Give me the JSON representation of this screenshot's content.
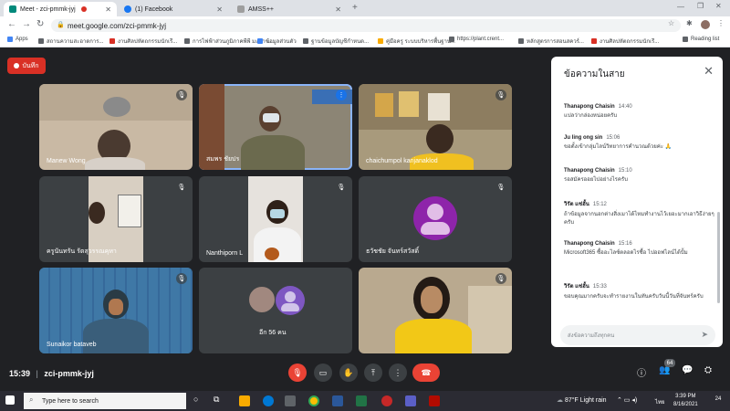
{
  "browser": {
    "tabs": [
      {
        "title": "Meet - zci-pmmk-jyj",
        "active": true
      },
      {
        "title": "(1) Facebook",
        "active": false
      },
      {
        "title": "AMSS++",
        "active": false
      }
    ],
    "url": "meet.google.com/zci-pmmk-jyj",
    "bookmarks": [
      "Apps",
      "สถานความสะอาดการ...",
      "งานศิลปหัตถกรรมนักเรี...",
      "การไฟฟ้าส่วนภูมิภาคพีพี มะนาว...",
      "ข้อมูลส่วนตัว",
      "ฐานข้อมูลบัญชีกำหนด...",
      "คู่มือครู ระบบบริหารพื้นฐาน...",
      "https://plant.crent...",
      "หลักสูตรการสอนสควร์...",
      "งานศิลปหัตถกรรมนักเรี..."
    ],
    "reading_list": "Reading list"
  },
  "meet": {
    "record_label": "บันทึก",
    "meeting_code": "zci-pmmk-jyj",
    "time": "15:39",
    "participant_count": "64",
    "tiles": [
      {
        "name": "Manew Wong",
        "type": "video"
      },
      {
        "name": "สมพร ชัยปร",
        "type": "video",
        "speaking": true
      },
      {
        "name": "chaichumpol kanjanaklod",
        "type": "video"
      },
      {
        "name": "ครูนันทรัน รัตสุวรรณคุหา",
        "type": "video"
      },
      {
        "name": "Nanthiporn L",
        "type": "video"
      },
      {
        "name": "ธวัชชัย จันทร์สวัสดิ์",
        "type": "avatar"
      },
      {
        "name": "Sunaikor bataveb",
        "type": "video"
      },
      {
        "name": "อีก 56 คน",
        "type": "others"
      },
      {
        "name": "",
        "type": "video"
      }
    ]
  },
  "chat": {
    "title": "ข้อความในสาย",
    "messages": [
      {
        "sender": "Thanapong Chaisin",
        "time": "14:40",
        "text": "แปลว่ากล่องหน่อยครับ"
      },
      {
        "sender": "Ju ling ong sin",
        "time": "15:06",
        "text": "ขอตั้งเข้ากลุ่มไลน์วิทยาการคำนวณด้วยค่ะ 🙏"
      },
      {
        "sender": "Thanapong Chaisin",
        "time": "15:10",
        "text": "รอสมัครออยไปอย่างไรครับ"
      },
      {
        "sender": "วิรัต แซ่ฮั้น",
        "time": "15:12",
        "text": "ถ้าข้อมูลจากนอกต่างสิ่งเมาได้ไหมทำงานไว้เยอะมากเอาวิธีง่ายๆครับ"
      },
      {
        "sender": "Thanapong Chaisin",
        "time": "15:16",
        "text": "Microsoft365 ซื้ออะไลซ์ตลอดไรซื้อ ไปออฟไลน์ได้ปั้ม"
      },
      {
        "sender": "วิรัต แซ่ฮั้น",
        "time": "15:33",
        "text": "ขอบคุณมากครับจะทำรายงานในทันครับวันนี้วันที่จันทร์ครับ"
      }
    ],
    "input_placeholder": "ส่งข้อความถึงทุกคน"
  },
  "taskbar": {
    "search_placeholder": "Type here to search",
    "weather": "87°F  Light rain",
    "time": "3:39 PM",
    "date": "8/16/2021",
    "lang": "ไทย",
    "notification_count": "24"
  }
}
